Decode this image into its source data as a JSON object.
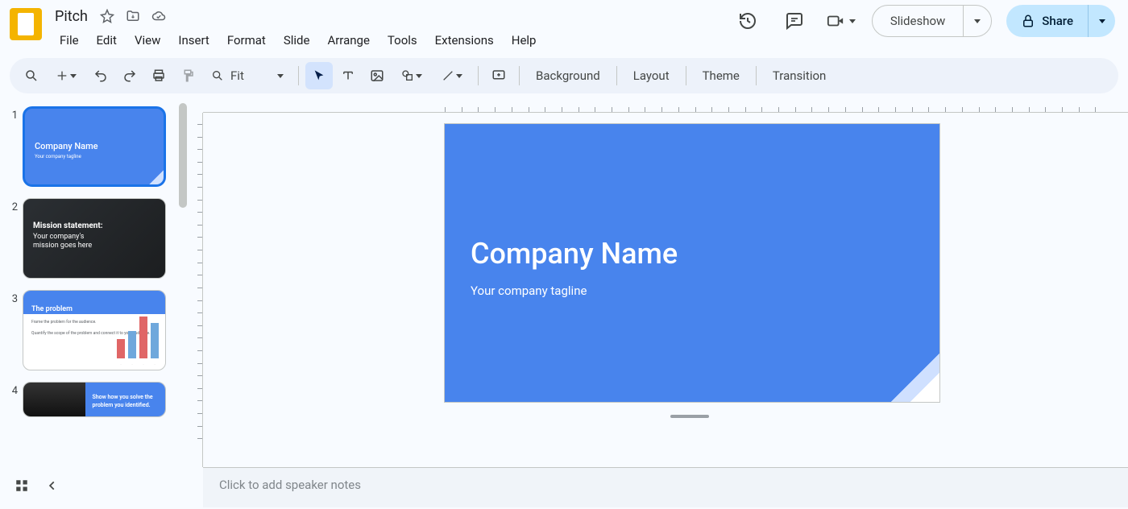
{
  "doc": {
    "title": "Pitch"
  },
  "menu": {
    "file": "File",
    "edit": "Edit",
    "view": "View",
    "insert": "Insert",
    "format": "Format",
    "slide": "Slide",
    "arrange": "Arrange",
    "tools": "Tools",
    "extensions": "Extensions",
    "help": "Help"
  },
  "header_buttons": {
    "slideshow": "Slideshow",
    "share": "Share"
  },
  "toolbar": {
    "zoom": "Fit",
    "background": "Background",
    "layout": "Layout",
    "theme": "Theme",
    "transition": "Transition"
  },
  "thumbs": [
    {
      "num": "1",
      "title": "Company Name",
      "subtitle": "Your company tagline"
    },
    {
      "num": "2",
      "line1": "Mission statement:",
      "line2": "Your company's",
      "line3": "mission goes here"
    },
    {
      "num": "3",
      "title": "The problem",
      "line1": "Frame the problem for the audience.",
      "line2": "Quantify the scope of the problem and connect it to your audience."
    },
    {
      "num": "4",
      "line1": "Show how you solve the",
      "line2": "problem you identified."
    }
  ],
  "canvas": {
    "title": "Company Name",
    "subtitle": "Your company tagline"
  },
  "notes": {
    "placeholder": "Click to add speaker notes"
  }
}
